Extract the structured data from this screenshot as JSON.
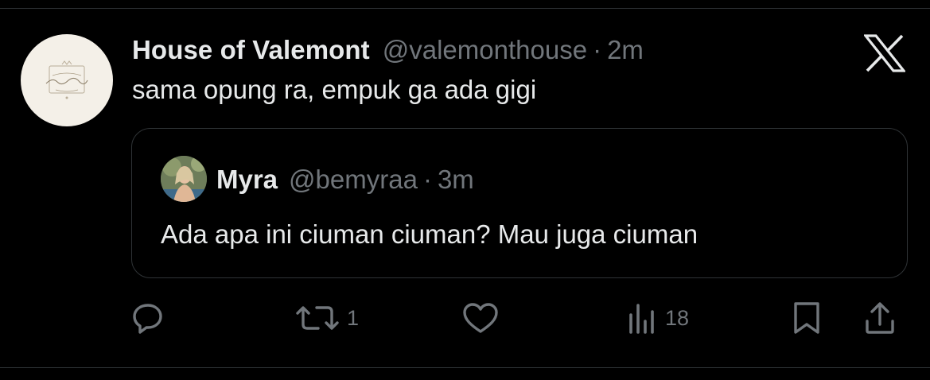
{
  "tweet": {
    "display_name": "House of Valemont",
    "handle": "@valemonthouse",
    "separator": "·",
    "time": "2m",
    "text": "sama opung ra, empuk ga ada gigi",
    "avatar_lettering": "The House Of Valemont"
  },
  "quoted_tweet": {
    "display_name": "Myra",
    "handle": "@bemyraa",
    "separator": "·",
    "time": "3m",
    "text": "Ada apa ini ciuman ciuman? Mau juga ciuman"
  },
  "actions": {
    "reply": {
      "icon": "reply-icon"
    },
    "retweet": {
      "icon": "retweet-icon",
      "count": "1"
    },
    "like": {
      "icon": "heart-icon"
    },
    "views": {
      "icon": "views-icon",
      "count": "18"
    },
    "bookmark": {
      "icon": "bookmark-icon"
    },
    "share": {
      "icon": "share-icon"
    }
  },
  "colors": {
    "background": "#000000",
    "primary_text": "#e7e9ea",
    "secondary_text": "#71767b",
    "border": "#2f3336"
  }
}
